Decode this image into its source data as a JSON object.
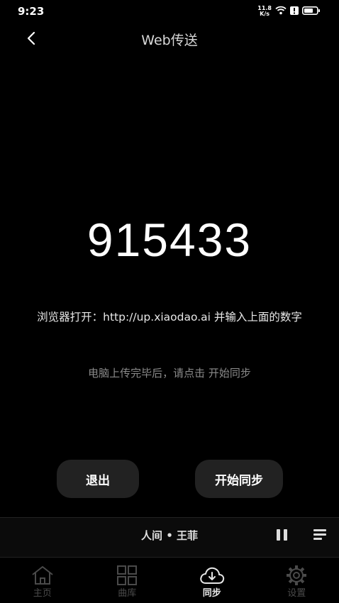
{
  "status_bar": {
    "time": "9:23",
    "net_speed_value": "11.8",
    "net_speed_unit": "K/s"
  },
  "header": {
    "title": "Web传送"
  },
  "main": {
    "code": "915433",
    "instruction": "浏览器打开：http://up.xiaodao.ai 并输入上面的数字",
    "hint": "电脑上传完毕后，请点击 开始同步",
    "exit_label": "退出",
    "start_sync_label": "开始同步"
  },
  "player": {
    "now_playing": "人间 • 王菲"
  },
  "tabs": [
    {
      "label": "主页",
      "icon": "home-icon",
      "active": false
    },
    {
      "label": "曲库",
      "icon": "grid-icon",
      "active": false
    },
    {
      "label": "同步",
      "icon": "cloud-download-icon",
      "active": true
    },
    {
      "label": "设置",
      "icon": "gear-icon",
      "active": false
    }
  ],
  "colors": {
    "background": "#000000",
    "button_bg": "#222222",
    "inactive_tab": "#4a4a4a",
    "hint_text": "#8a8a8a"
  }
}
